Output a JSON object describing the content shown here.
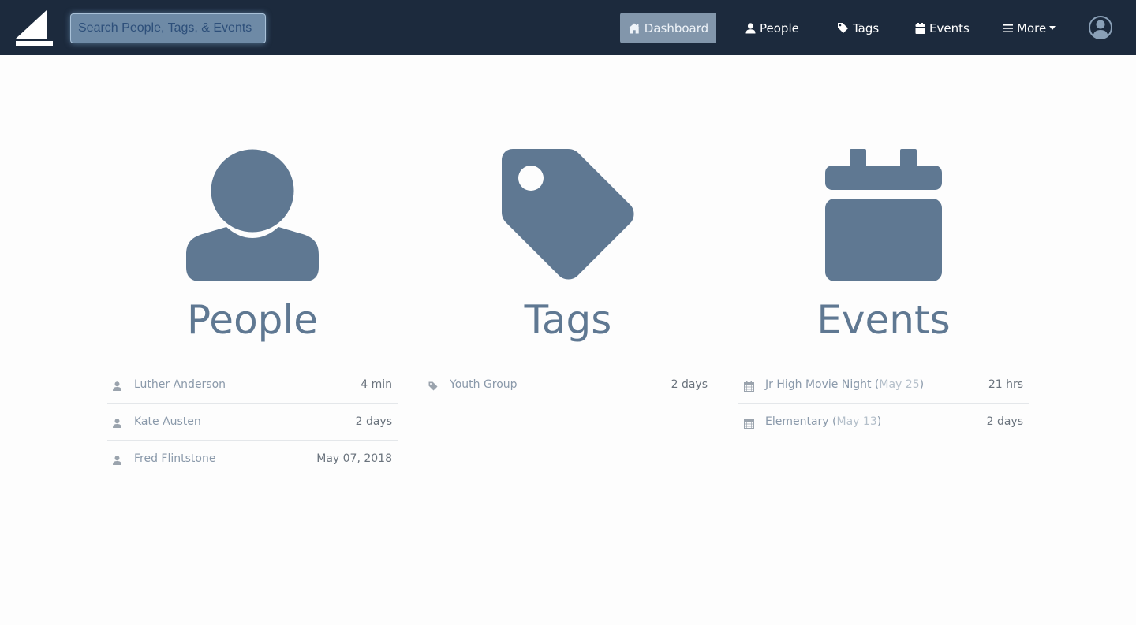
{
  "nav": {
    "search_placeholder": "Search People, Tags, & Events",
    "dashboard_label": "Dashboard",
    "people_label": "People",
    "tags_label": "Tags",
    "events_label": "Events",
    "more_label": "More"
  },
  "people": {
    "title": "People",
    "items": [
      {
        "name": "Luther Anderson",
        "time": "4 min"
      },
      {
        "name": "Kate Austen",
        "time": "2 days"
      },
      {
        "name": "Fred Flintstone",
        "time": "May 07, 2018"
      }
    ]
  },
  "tags": {
    "title": "Tags",
    "items": [
      {
        "name": "Youth Group",
        "time": "2 days"
      }
    ]
  },
  "events": {
    "title": "Events",
    "items": [
      {
        "name": "Jr High Movie Night",
        "date": "May 25",
        "time": "21 hrs"
      },
      {
        "name": "Elementary",
        "date": "May 13",
        "time": "2 days"
      }
    ]
  },
  "colors": {
    "navbar": "#1c2a3d",
    "accent": "#5f7892",
    "dashboard_active": "#8296ab"
  }
}
